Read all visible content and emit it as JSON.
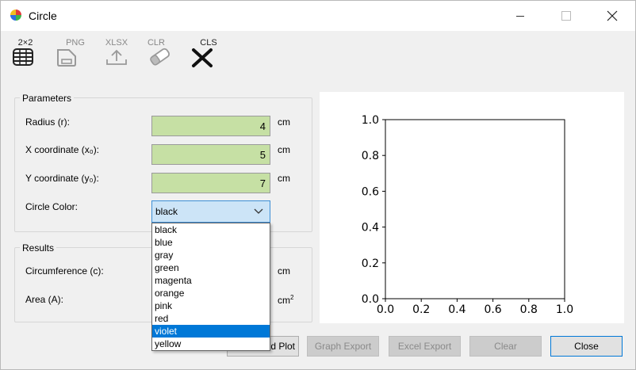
{
  "window": {
    "title": "Circle"
  },
  "toolbar": {
    "grid": "2×2",
    "png": "PNG",
    "xlsx": "XLSX",
    "clr": "CLR",
    "cls": "CLS"
  },
  "parameters": {
    "title": "Parameters",
    "radius": {
      "label": "Radius (r):",
      "value": "4",
      "unit": "cm"
    },
    "x": {
      "label": "X coordinate (x₀):",
      "value": "5",
      "unit": "cm"
    },
    "y": {
      "label": "Y coordinate (y₀):",
      "value": "7",
      "unit": "cm"
    },
    "color": {
      "label": "Circle Color:",
      "selected": "black",
      "options": [
        "black",
        "blue",
        "gray",
        "green",
        "magenta",
        "orange",
        "pink",
        "red",
        "violet",
        "yellow"
      ],
      "highlighted": "violet"
    }
  },
  "results": {
    "title": "Results",
    "circumference": {
      "label": "Circumference (c):",
      "unit": "cm"
    },
    "area": {
      "label": "Area (A):",
      "unit": "cm",
      "unit_sup": "2"
    }
  },
  "buttons": {
    "plot": "Plot",
    "plot_partial": "d Plot",
    "graph_export": "Graph Export",
    "excel_export": "Excel Export",
    "clear": "Clear",
    "close": "Close"
  },
  "chart_data": {
    "type": "line",
    "series": [],
    "xlim": [
      0.0,
      1.0
    ],
    "ylim": [
      0.0,
      1.0
    ],
    "xticks": [
      "0.0",
      "0.2",
      "0.4",
      "0.6",
      "0.8",
      "1.0"
    ],
    "yticks": [
      "0.0",
      "0.2",
      "0.4",
      "0.6",
      "0.8",
      "1.0"
    ],
    "grid": false
  }
}
